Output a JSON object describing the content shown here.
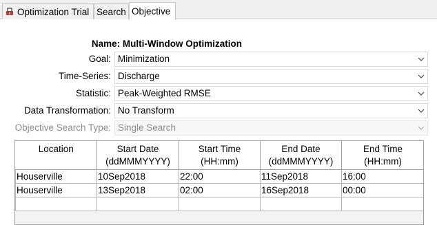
{
  "tabs": [
    {
      "label": "Optimization Trial",
      "icon": "trial-wrench-icon",
      "active": false
    },
    {
      "label": "Search",
      "active": false
    },
    {
      "label": "Objective",
      "active": true
    }
  ],
  "form": {
    "name_label": "Name:",
    "name_value": "Multi-Window Optimization",
    "goal": {
      "label": "Goal:",
      "value": "Minimization"
    },
    "time_series": {
      "label": "Time-Series:",
      "value": "Discharge"
    },
    "statistic": {
      "label": "Statistic:",
      "value": "Peak-Weighted RMSE"
    },
    "transformation": {
      "label": "Data Transformation:",
      "value": "No Transform"
    },
    "search_type": {
      "label": "Objective Search Type:",
      "value": "Single Search",
      "disabled": true
    }
  },
  "table": {
    "columns": [
      {
        "title": "Location",
        "sub": ""
      },
      {
        "title": "Start Date",
        "sub": "(ddMMMYYYY)"
      },
      {
        "title": "Start Time",
        "sub": "(HH:mm)"
      },
      {
        "title": "End Date",
        "sub": "(ddMMMYYYY)"
      },
      {
        "title": "End Time",
        "sub": "(HH:mm)"
      }
    ],
    "rows": [
      [
        "Houserville",
        "10Sep2018",
        "22:00",
        "11Sep2018",
        "16:00"
      ],
      [
        "Houserville",
        "13Sep2018",
        "02:00",
        "16Sep2018",
        "00:00"
      ],
      [
        "",
        "",
        "",
        "",
        ""
      ]
    ]
  },
  "colors": {
    "accent_icon_red": "#c0392b",
    "border": "#a0a0a0",
    "disabled_text": "#8c8c8c"
  }
}
